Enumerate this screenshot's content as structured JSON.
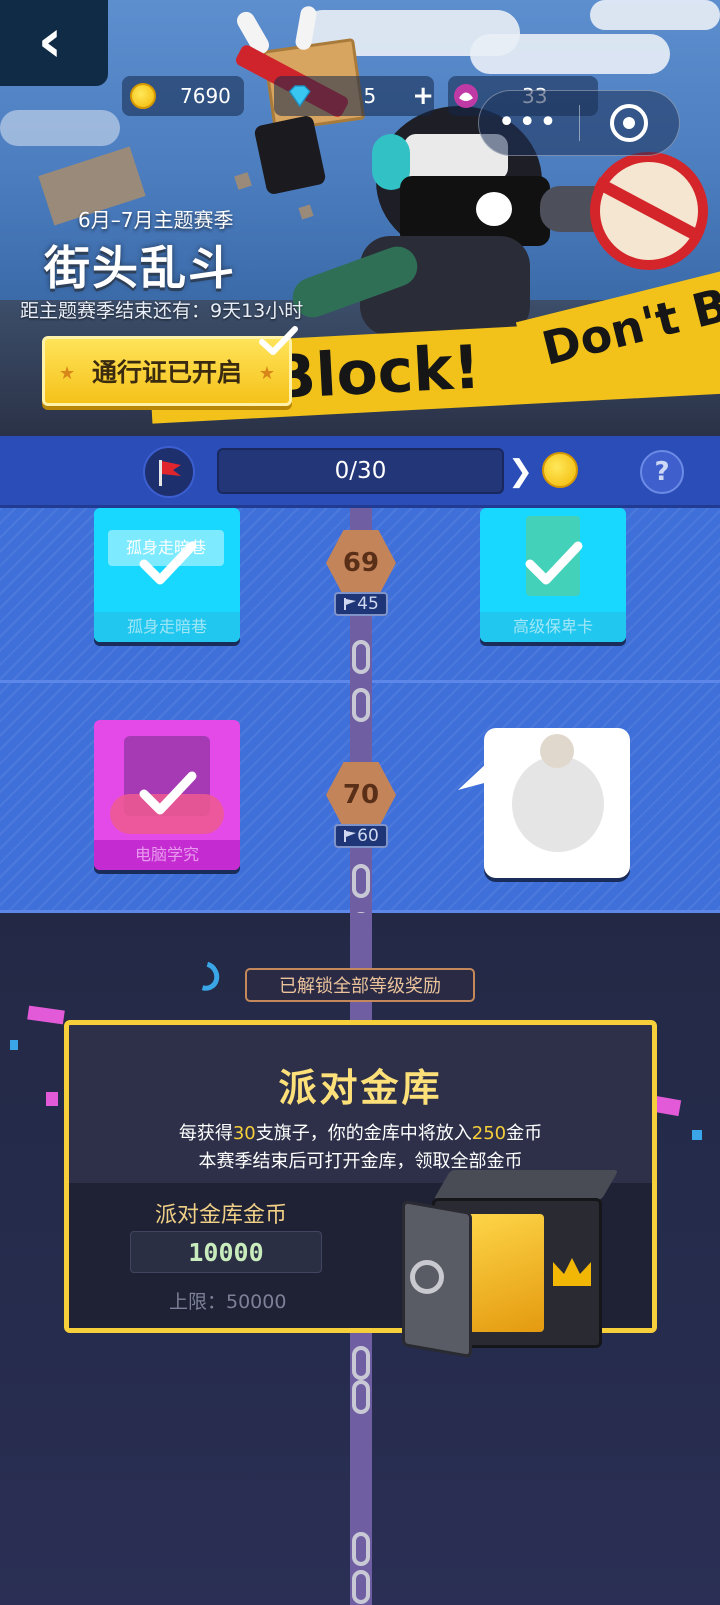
{
  "header": {
    "back_icon": "chevron-left-icon",
    "currencies": [
      {
        "icon": "coin-icon",
        "value": "7690"
      },
      {
        "icon": "diamond-icon",
        "value": "5",
        "add": "+"
      },
      {
        "icon": "lotus-icon",
        "value": "33"
      }
    ],
    "mini_program_capsule": {
      "more_icon": "more-dots-icon",
      "close_icon": "target-icon"
    }
  },
  "season": {
    "subtitle": "6月–7月主题赛季",
    "title": "街头乱斗",
    "countdown": "距主题赛季结束还有：9天13小时",
    "pass_button": "通行证已开启",
    "banner_tape": [
      "Block!",
      "Don't B"
    ]
  },
  "level_bar": {
    "progress": "0/30",
    "help": "?"
  },
  "rewards": [
    {
      "level": "69",
      "flags": "45",
      "left": {
        "name": "孤身走暗巷",
        "tag": "孤身走暗巷",
        "color": "#19d8ff",
        "claimed": true
      },
      "right": {
        "name": "高级保卑卡",
        "color": "#19d8ff",
        "claimed": true
      }
    },
    {
      "level": "70",
      "flags": "60",
      "left": {
        "name": "电脑学究",
        "color": "#e44ae8",
        "claimed": true
      },
      "right": {
        "name": "",
        "color": "#ffffff",
        "claimed": false
      }
    }
  ],
  "vault": {
    "unlock_all": "已解锁全部等级奖励",
    "title": "派对金库",
    "desc_line1": {
      "a": "每获得",
      "b": "30",
      "c": "支旗子，你的金库中将放入",
      "d": "250",
      "e": "金币"
    },
    "desc_line2": "本赛季结束后可打开金库，领取全部金币",
    "coins_label": "派对金库金币",
    "coins_value": "10000",
    "limit": "上限：50000"
  }
}
